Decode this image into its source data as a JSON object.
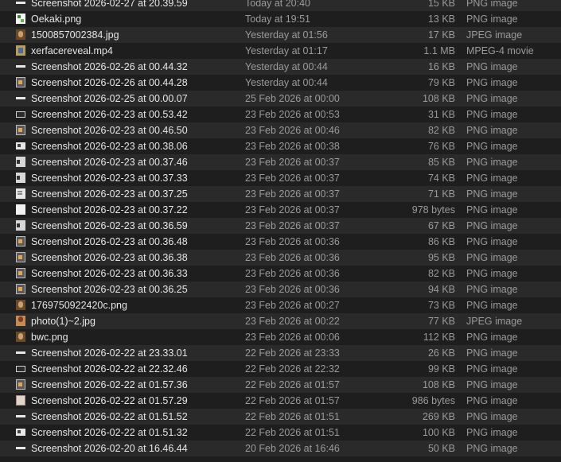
{
  "files": [
    {
      "name": "Screenshot 2026-02-27 at 20.39.59",
      "date": "Today at 20:40",
      "size": "15 KB",
      "kind": "PNG image",
      "icon": "line"
    },
    {
      "name": "Oekaki.png",
      "date": "Today at 19:51",
      "size": "13 KB",
      "kind": "PNG image",
      "icon": "oekaki"
    },
    {
      "name": "1500857002384.jpg",
      "date": "Yesterday at 01:56",
      "size": "17 KB",
      "kind": "JPEG image",
      "icon": "photo"
    },
    {
      "name": "xerfacereveal.mp4",
      "date": "Yesterday at 01:17",
      "size": "1.1 MB",
      "kind": "MPEG-4 movie",
      "icon": "video"
    },
    {
      "name": "Screenshot 2026-02-26 at 00.44.32",
      "date": "Yesterday at 00:44",
      "size": "16 KB",
      "kind": "PNG image",
      "icon": "line"
    },
    {
      "name": "Screenshot 2026-02-26 at 00.44.28",
      "date": "Yesterday at 00:44",
      "size": "79 KB",
      "kind": "PNG image",
      "icon": "dark"
    },
    {
      "name": "Screenshot 2026-02-25 at 00.00.07",
      "date": "25 Feb 2026 at 00:00",
      "size": "108 KB",
      "kind": "PNG image",
      "icon": "line"
    },
    {
      "name": "Screenshot 2026-02-23 at 00.53.42",
      "date": "23 Feb 2026 at 00:53",
      "size": "31 KB",
      "kind": "PNG image",
      "icon": "box"
    },
    {
      "name": "Screenshot 2026-02-23 at 00.46.50",
      "date": "23 Feb 2026 at 00:46",
      "size": "82 KB",
      "kind": "PNG image",
      "icon": "dark"
    },
    {
      "name": "Screenshot 2026-02-23 at 00.38.06",
      "date": "23 Feb 2026 at 00:38",
      "size": "76 KB",
      "kind": "PNG image",
      "icon": "wide"
    },
    {
      "name": "Screenshot 2026-02-23 at 00.37.46",
      "date": "23 Feb 2026 at 00:37",
      "size": "85 KB",
      "kind": "PNG image",
      "icon": "bar"
    },
    {
      "name": "Screenshot 2026-02-23 at 00.37.33",
      "date": "23 Feb 2026 at 00:37",
      "size": "74 KB",
      "kind": "PNG image",
      "icon": "bar"
    },
    {
      "name": "Screenshot 2026-02-23 at 00.37.25",
      "date": "23 Feb 2026 at 00:37",
      "size": "71 KB",
      "kind": "PNG image",
      "icon": "sheet"
    },
    {
      "name": "Screenshot 2026-02-23 at 00.37.22",
      "date": "23 Feb 2026 at 00:37",
      "size": "978 bytes",
      "kind": "PNG image",
      "icon": "white"
    },
    {
      "name": "Screenshot 2026-02-23 at 00.36.59",
      "date": "23 Feb 2026 at 00:37",
      "size": "67 KB",
      "kind": "PNG image",
      "icon": "bar"
    },
    {
      "name": "Screenshot 2026-02-23 at 00.36.48",
      "date": "23 Feb 2026 at 00:36",
      "size": "86 KB",
      "kind": "PNG image",
      "icon": "dark"
    },
    {
      "name": "Screenshot 2026-02-23 at 00.36.38",
      "date": "23 Feb 2026 at 00:36",
      "size": "95 KB",
      "kind": "PNG image",
      "icon": "dark"
    },
    {
      "name": "Screenshot 2026-02-23 at 00.36.33",
      "date": "23 Feb 2026 at 00:36",
      "size": "82 KB",
      "kind": "PNG image",
      "icon": "dark"
    },
    {
      "name": "Screenshot 2026-02-23 at 00.36.25",
      "date": "23 Feb 2026 at 00:36",
      "size": "94 KB",
      "kind": "PNG image",
      "icon": "dark"
    },
    {
      "name": "1769750922420c.png",
      "date": "23 Feb 2026 at 00:27",
      "size": "73 KB",
      "kind": "PNG image",
      "icon": "photo"
    },
    {
      "name": "photo(1)~2.jpg",
      "date": "23 Feb 2026 at 00:22",
      "size": "77 KB",
      "kind": "JPEG image",
      "icon": "portrait"
    },
    {
      "name": "bwc.png",
      "date": "23 Feb 2026 at 00:06",
      "size": "112 KB",
      "kind": "PNG image",
      "icon": "photo"
    },
    {
      "name": "Screenshot 2026-02-22 at 23.33.01",
      "date": "22 Feb 2026 at 23:33",
      "size": "26 KB",
      "kind": "PNG image",
      "icon": "line"
    },
    {
      "name": "Screenshot 2026-02-22 at 22.32.46",
      "date": "22 Feb 2026 at 22:32",
      "size": "99 KB",
      "kind": "PNG image",
      "icon": "box"
    },
    {
      "name": "Screenshot 2026-02-22 at 01.57.36",
      "date": "22 Feb 2026 at 01:57",
      "size": "108 KB",
      "kind": "PNG image",
      "icon": "dark"
    },
    {
      "name": "Screenshot 2026-02-22 at 01.57.29",
      "date": "22 Feb 2026 at 01:57",
      "size": "986 bytes",
      "kind": "PNG image",
      "icon": "tall"
    },
    {
      "name": "Screenshot 2026-02-22 at 01.51.52",
      "date": "22 Feb 2026 at 01:51",
      "size": "269 KB",
      "kind": "PNG image",
      "icon": "line"
    },
    {
      "name": "Screenshot 2026-02-22 at 01.51.32",
      "date": "22 Feb 2026 at 01:51",
      "size": "100 KB",
      "kind": "PNG image",
      "icon": "wide"
    },
    {
      "name": "Screenshot 2026-02-20 at 16.46.44",
      "date": "20 Feb 2026 at 16:46",
      "size": "50 KB",
      "kind": "PNG image",
      "icon": "line"
    }
  ]
}
